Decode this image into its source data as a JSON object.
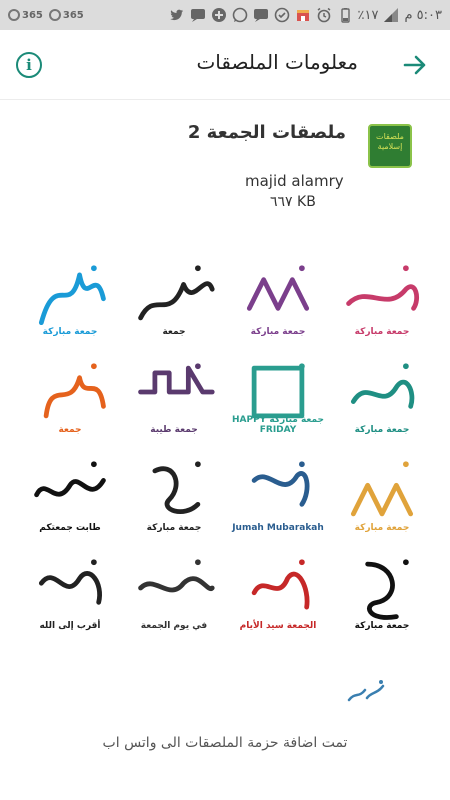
{
  "status_bar": {
    "time": "٥:٠٣ م",
    "battery": "٪١٧",
    "apps": [
      "365",
      "365"
    ]
  },
  "header": {
    "title": "معلومات الملصقات"
  },
  "pack": {
    "tray_text": "ملصقات إسلامية",
    "name": "ملصقات الجمعة 2",
    "publisher": "majid alamry",
    "size": "٦٦٧ KB"
  },
  "stickers": [
    {
      "label": "جمعة مباركة",
      "color": "#1a9bd7"
    },
    {
      "label": "جمعة",
      "color": "#222222"
    },
    {
      "label": "جمعة مباركة",
      "color": "#7b3f8c"
    },
    {
      "label": "جمعة مباركة",
      "color": "#c73b6a"
    },
    {
      "label": "جمعة",
      "color": "#e5621d"
    },
    {
      "label": "جمعة طيبة",
      "color": "#5a3a6e"
    },
    {
      "label": "جمعة مباركة HAPPY FRIDAY",
      "color": "#2a9d8f"
    },
    {
      "label": "جمعة مباركة",
      "color": "#1f8f83"
    },
    {
      "label": "طابت جمعتكم",
      "color": "#111111"
    },
    {
      "label": "جمعة مباركة",
      "color": "#222222"
    },
    {
      "label": "Jumah Mubarakah",
      "color": "#2a5d8f"
    },
    {
      "label": "جمعة مباركة",
      "color": "#e0a33b"
    },
    {
      "label": "أقرب إلى الله",
      "color": "#222222"
    },
    {
      "label": "في يوم الجمعة",
      "color": "#333333"
    },
    {
      "label": "الجمعة سيد الأيام",
      "color": "#c62828"
    },
    {
      "label": "جمعة مباركة",
      "color": "#111111"
    }
  ],
  "footer": {
    "message": "تمت اضافة حزمة الملصقات الى واتس اب"
  },
  "colors": {
    "accent": "#1b8a78",
    "status_bar": "#dcdcdc"
  }
}
